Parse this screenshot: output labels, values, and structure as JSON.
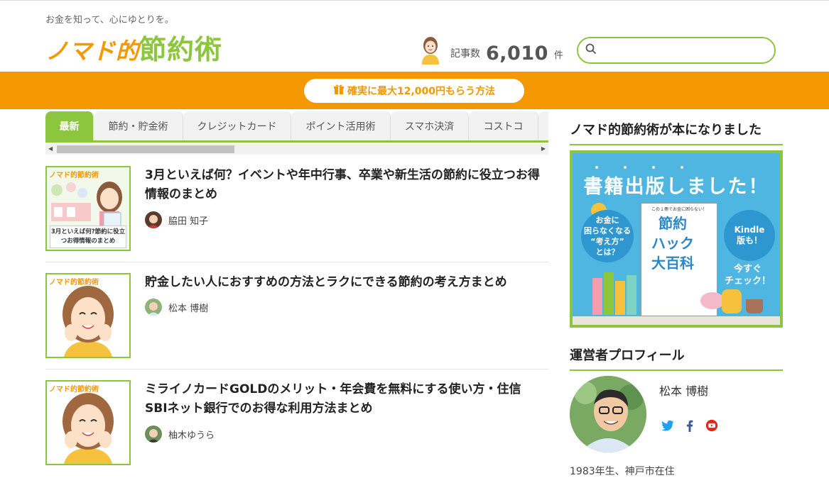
{
  "header": {
    "tagline": "お金を知って、心にゆとりを。",
    "logo_part1": "ノマド的",
    "logo_part2": "節約術",
    "article_count_label": "記事数",
    "article_count": "6,010",
    "article_count_unit": "件",
    "search_placeholder": ""
  },
  "banner": {
    "label": "確実に最大12,000円もらう方法"
  },
  "tabs": [
    {
      "label": "最新",
      "active": true
    },
    {
      "label": "節約・貯金術",
      "active": false
    },
    {
      "label": "クレジットカード",
      "active": false
    },
    {
      "label": "ポイント活用術",
      "active": false
    },
    {
      "label": "スマホ決済",
      "active": false
    },
    {
      "label": "コストコ",
      "active": false
    }
  ],
  "articles": [
    {
      "title": "3月といえば何？イベントや年中行事、卒業や新生活の節約に役立つお得情報のまとめ",
      "thumb_logo": "ノマド的節約術",
      "thumb_caption": "3月といえば何?節約に役立つお得情報のまとめ",
      "author": "脇田 知子"
    },
    {
      "title": "貯金したい人におすすめの方法とラクにできる節約の考え方まとめ",
      "thumb_logo": "ノマド的節約術",
      "author": "松本 博樹"
    },
    {
      "title": "ミライノカードGOLDのメリット・年会費を無料にする使い方・住信SBIネット銀行でのお得な利用方法まとめ",
      "thumb_logo": "ノマド的節約術",
      "author": "柚木ゆうら"
    }
  ],
  "sidebar": {
    "book_heading": "ノマド的節約術が本になりました",
    "book_banner": {
      "headline": "書籍出版しました！",
      "cover_top": "この１冊でお金に困らない！",
      "cover_line1": "節約",
      "cover_line2": "ハック",
      "cover_line3": "大百科",
      "left_circle_1": "お金に",
      "left_circle_2": "困らなくなる",
      "left_circle_3": "“考え方”",
      "left_circle_4": "とは？",
      "right_circle_1": "Kindle",
      "right_circle_2": "版も！",
      "check_1": "今すぐ",
      "check_2": "チェック！"
    },
    "profile_heading": "運営者プロフィール",
    "profile_name": "松本 博樹",
    "profile_bio": "1983年生、神戸市在住"
  },
  "colors": {
    "brand_green": "#8cc63f",
    "brand_orange": "#f39800",
    "twitter": "#1da1f2",
    "facebook": "#3b5998",
    "youtube": "#e62117"
  }
}
